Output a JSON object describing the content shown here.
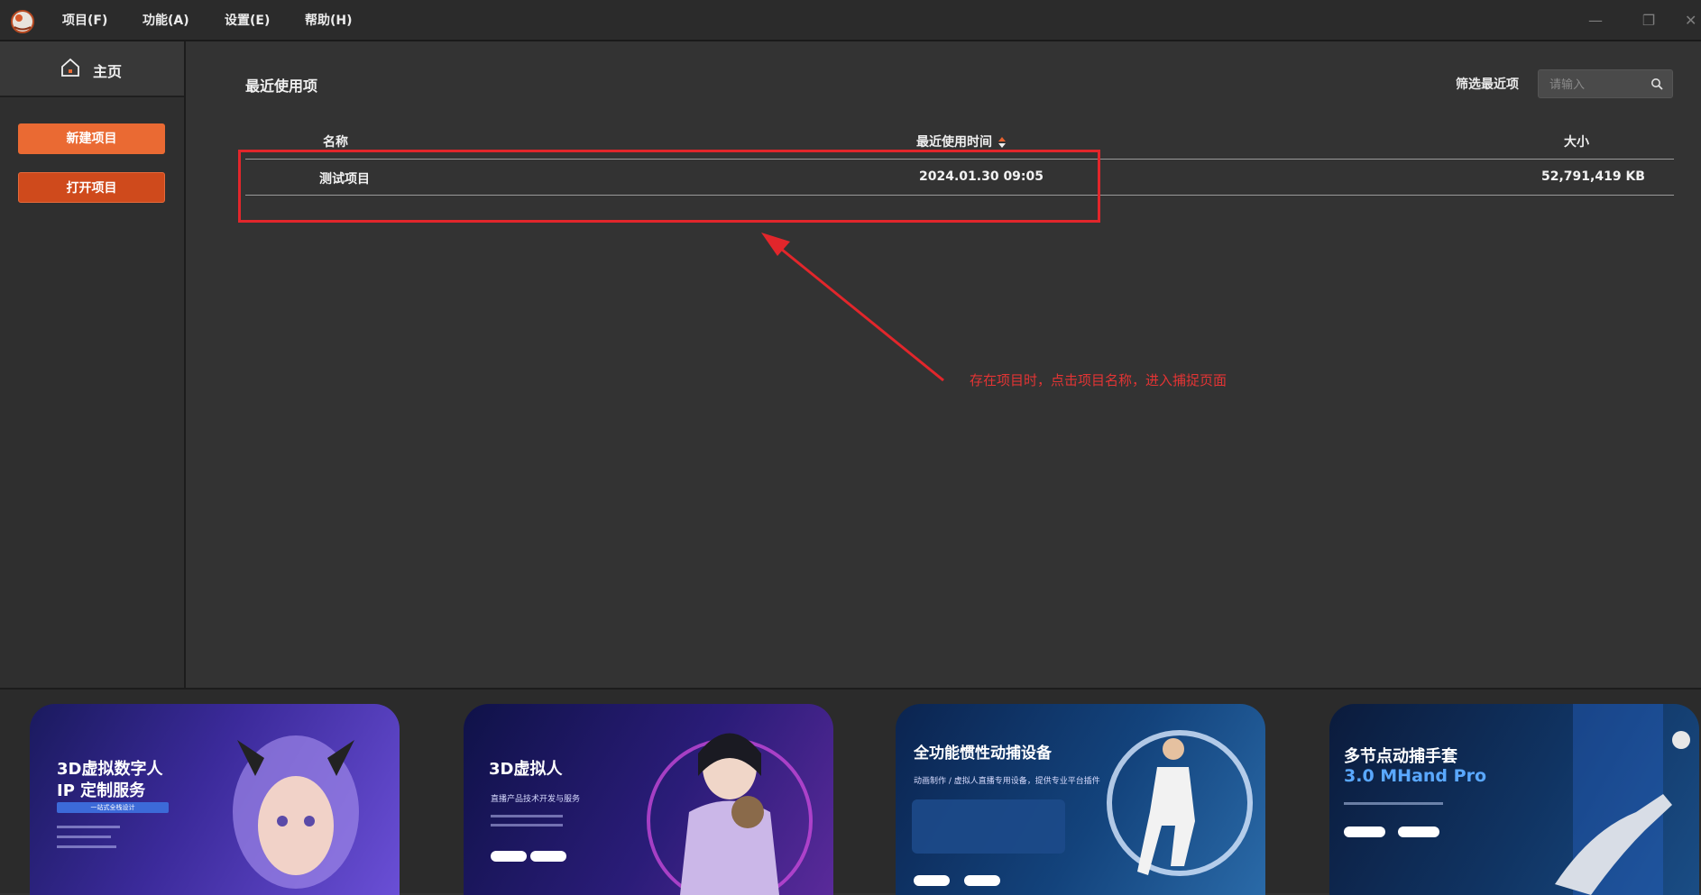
{
  "menu": {
    "project": "项目(F)",
    "function": "功能(A)",
    "settings": "设置(E)",
    "help": "帮助(H)"
  },
  "sidebar": {
    "home_label": "主页",
    "new_project": "新建项目",
    "open_project": "打开项目"
  },
  "main": {
    "section_title": "最近使用项",
    "filter_label": "筛选最近项",
    "search_placeholder": "请输入",
    "columns": {
      "name": "名称",
      "last_used": "最近使用时间",
      "size": "大小"
    },
    "rows": [
      {
        "name": "测试项目",
        "last_used": "2024.01.30 09:05",
        "size": "52,791,419 KB"
      }
    ],
    "annotation": "存在项目时，点击项目名称，进入捕捉页面"
  },
  "banners": [
    {
      "title_line1": "3D虚拟数字人",
      "title_line2": "IP 定制服务",
      "tag": "一站式全栈设计"
    },
    {
      "title": "3D虚拟人",
      "subtitle": "直播产品技术开发与服务"
    },
    {
      "title": "全功能惯性动捕设备",
      "subtitle": "动画制作 / 虚拟人直播专用设备，提供专业平台插件"
    },
    {
      "title_line1": "多节点动捕手套",
      "title_line2": "3.0 MHand Pro"
    }
  ],
  "colors": {
    "accent_orange": "#ea6a33",
    "accent_dark_orange": "#cf4a1c",
    "annotation_red": "#e2262b"
  }
}
